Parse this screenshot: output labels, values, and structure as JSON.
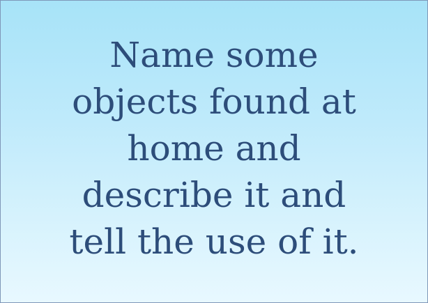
{
  "slide": {
    "lines": [
      "Name some",
      "objects found at",
      "home and",
      "describe it and",
      "tell the use of it."
    ]
  }
}
